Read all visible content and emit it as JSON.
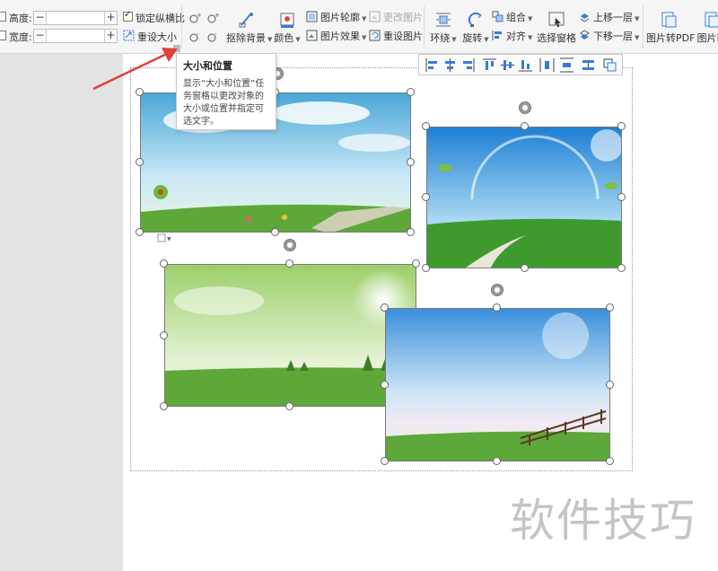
{
  "ribbon": {
    "height_label": "高度:",
    "width_label": "宽度:",
    "height_value": "",
    "width_value": "",
    "lock_ratio_label": "锁定纵横比",
    "lock_ratio_checked": true,
    "reset_size_label": "重设大小",
    "remove_bg_label": "抠除背景",
    "color_label": "颜色",
    "outline_label": "图片轮廓",
    "effect_label": "图片效果",
    "change_pic_label": "更改图片",
    "reset_pic_label": "重设图片",
    "wrap_label": "环绕",
    "rotate_label": "旋转",
    "group_label": "组合",
    "align_label": "对齐",
    "select_pane_label": "选择窗格",
    "bring_forward_label": "上移一层",
    "send_backward_label": "下移一层",
    "pic_to_pdf_label": "图片转PDF",
    "pic_convert_label": "图片转"
  },
  "tooltip": {
    "title": "大小和位置",
    "body": "显示“大小和位置”任务窗格以更改对象的大小或位置并指定可选文字。"
  },
  "watermark": "软件技巧",
  "colors": {
    "accent": "#2b6cc4",
    "arrow": "#e0403a",
    "ribbon_bg": "#f5f5f5",
    "workspace_bg": "#e3e3e3"
  }
}
